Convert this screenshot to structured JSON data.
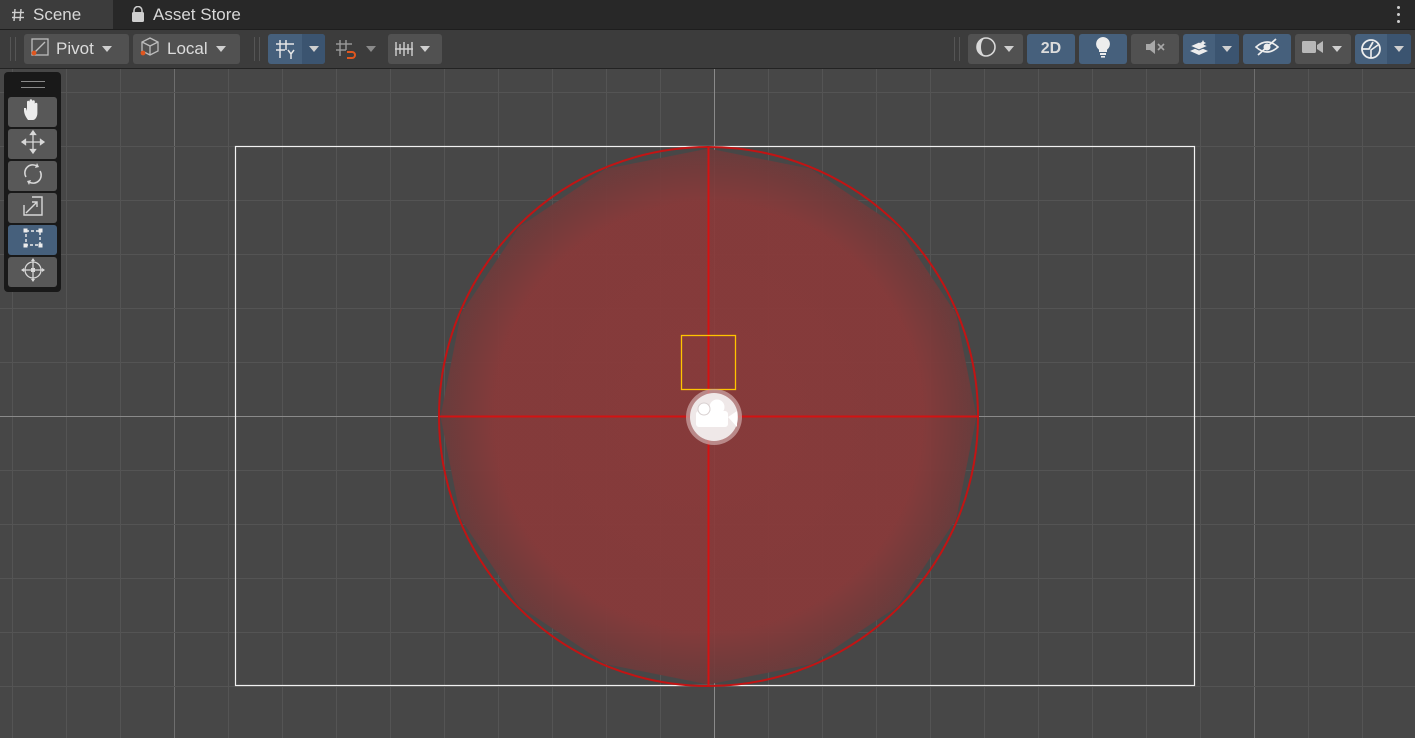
{
  "tabs": [
    {
      "label": "Scene",
      "icon": "hash-icon",
      "active": true
    },
    {
      "label": "Asset Store",
      "icon": "bag-icon",
      "active": false
    }
  ],
  "toolbar": {
    "pivot_label": "Pivot",
    "local_label": "Local",
    "mode_2d_label": "2D"
  },
  "tools": [
    {
      "name": "hand-tool",
      "icon": "hand-icon",
      "active": false
    },
    {
      "name": "move-tool",
      "icon": "move-arrows-icon",
      "active": false
    },
    {
      "name": "rotate-tool",
      "icon": "rotate-icon",
      "active": false
    },
    {
      "name": "scale-tool",
      "icon": "scale-icon",
      "active": false
    },
    {
      "name": "rect-tool",
      "icon": "rect-transform-icon",
      "active": true
    },
    {
      "name": "transform-tool",
      "icon": "transform-icon",
      "active": false
    }
  ],
  "scene": {
    "camera_icon": "camera-icon",
    "colors": {
      "background": "#474747",
      "grid": "#585858",
      "axis": "#8a8a8a",
      "frame": "#ffffff",
      "light_range": "#c01818",
      "light_fill": "#8a3a3a",
      "selection": "#ffc400",
      "toolbar_active": "#46607c"
    }
  }
}
